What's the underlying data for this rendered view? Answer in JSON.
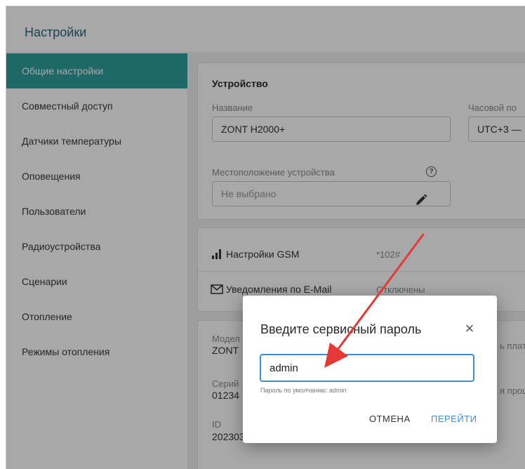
{
  "header": {
    "title": "Настройки"
  },
  "sidebar": {
    "items": [
      {
        "label": "Общие настройки",
        "active": true
      },
      {
        "label": "Совместный доступ"
      },
      {
        "label": "Датчики температуры"
      },
      {
        "label": "Оповещения"
      },
      {
        "label": "Пользователи"
      },
      {
        "label": "Радиоустройства"
      },
      {
        "label": "Сценарии"
      },
      {
        "label": "Отопление"
      },
      {
        "label": "Режимы отопления"
      }
    ]
  },
  "device": {
    "title": "Устройство",
    "name_label": "Название",
    "name_value": "ZONT H2000+",
    "timezone_label": "Часовой по",
    "timezone_value": "UTC+3 —",
    "location_label": "Местоположение устройства",
    "location_placeholder": "Не выбрано",
    "help_icon": "question-circle-icon",
    "edit_icon": "pencil-icon"
  },
  "settings_rows": [
    {
      "icon": "signal-bars-icon",
      "label": "Настройки GSM",
      "value": "*102#"
    },
    {
      "icon": "mail-icon",
      "label": "Уведомления по E-Mail",
      "value": "Отключены"
    }
  ],
  "info": {
    "model_label": "Модел",
    "model_value": "ZONT",
    "serial_label": "Серий",
    "serial_value": "01234",
    "id_label": "ID",
    "id_value": "202303",
    "right_1": "ь плат",
    "right_2": "я проц"
  },
  "dialog": {
    "title": "Введите сервисный пароль",
    "close_icon": "close-icon",
    "input_value": "admin",
    "hint": "Пароль по умолчанию: admin",
    "cancel_label": "ОТМЕНА",
    "confirm_label": "ПЕРЕЙТИ"
  },
  "colors": {
    "accent": "#2f9e9e",
    "title": "#1f6b80",
    "link": "#3c8fd0",
    "annotation_arrow": "#e53935"
  }
}
